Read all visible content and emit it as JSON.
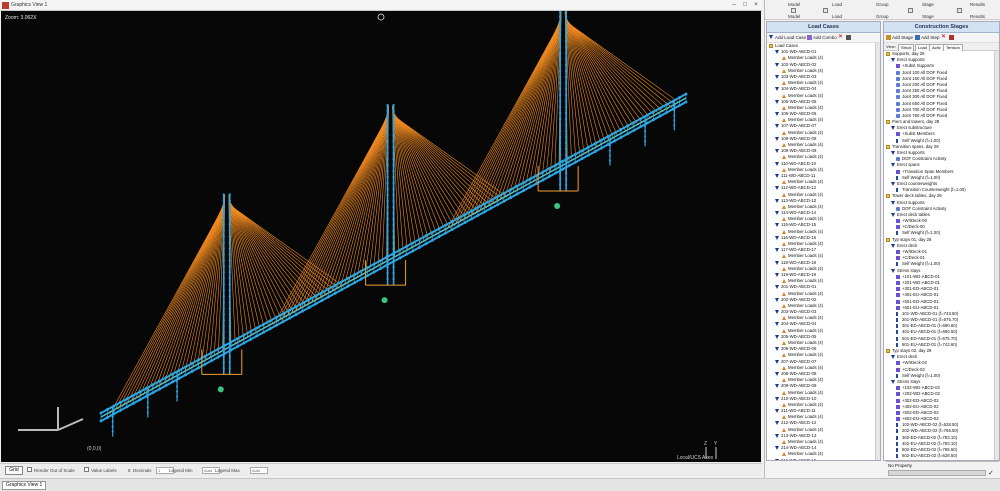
{
  "graphics_view": {
    "title": "Graphics View 1",
    "zoom": "Zoom: 3.062X",
    "origin": "(0,0,0)",
    "local_axes": "Local/UCS Axes",
    "axis_z": "Z",
    "axis_y": "Y",
    "colors": {
      "background": "#070707",
      "cable": "#f08a20",
      "member": "#2aa8e8",
      "deck_hl": "#4ec8d0",
      "support": "#f0a030"
    }
  },
  "status_bar": {
    "grid": "Grid",
    "render_out_of_scale": "Render Out of Scale",
    "value_labels": "Value Labels",
    "decimals_value": "8",
    "decimals_label": "Decimals",
    "legend_min_value": "1",
    "legend_min_label": "Legend Min",
    "legend_min_auto": "Auto",
    "legend_max_label": "Legend Max",
    "legend_max_auto": "Auto"
  },
  "bottom_tab": "Graphics View 1",
  "toolbar": {
    "groups": [
      {
        "top": "Model",
        "bottom": "Model"
      },
      {
        "top": "Load",
        "bottom": "Load"
      },
      {
        "top": "Group",
        "bottom": "Group"
      },
      {
        "top": "Stage",
        "bottom": "Stage"
      },
      {
        "top": "Results",
        "bottom": "Results"
      }
    ]
  },
  "load_cases": {
    "header": "Load Cases",
    "add_load_case": "Add Load Case",
    "add_combo": "Add Combo",
    "root": "Load Cases",
    "items": [
      "101-WD-ABCD-01",
      "102-WD-ABCD-02",
      "103-WD-ABCD-03",
      "104-WD-ABCD-04",
      "105-WD-ABCD-05",
      "106-WD-ABCD-06",
      "107-WD-ABCD-07",
      "108-WD-ABCD-08",
      "109-WD-ABCD-09",
      "110-WD-ABCD-10",
      "111-WD-ABCD-11",
      "112-WD-ABCD-12",
      "113-WD-ABCD-13",
      "114-WD-ABCD-14",
      "115-WD-ABCD-15",
      "116-WD-ABCD-16",
      "117-WD-ABCD-17",
      "118-WD-ABCD-18",
      "119-WD-ABCD-19",
      "201-WD-ABCD-01",
      "202-WD-ABCD-02",
      "203-WD-ABCD-03",
      "204-WD-ABCD-04",
      "205-WD-ABCD-05",
      "206-WD-ABCD-06",
      "207-WD-ABCD-07",
      "208-WD-ABCD-08",
      "209-WD-ABCD-09",
      "210-WD-ABCD-10",
      "211-WD-ABCD-11",
      "212-WD-ABCD-12",
      "213-WD-ABCD-13",
      "214-WD-ABCD-14",
      "215-WD-ABCD-15",
      "216-WD-ABCD-16"
    ],
    "child": "Member Loads (4)"
  },
  "construction_stages": {
    "header": "Construction Stages",
    "add_stage": "Add Stage",
    "add_step": "Add Step",
    "view_label": "View:",
    "subtabs": [
      "Struct",
      "Load",
      "Activ",
      "Tension"
    ],
    "rows": [
      {
        "lvl": 0,
        "kind": "folder",
        "text": "Supports, day 28"
      },
      {
        "lvl": 1,
        "kind": "step",
        "text": "Erect supports"
      },
      {
        "lvl": 2,
        "kind": "plus",
        "text": "+Subst Supports"
      },
      {
        "lvl": 2,
        "kind": "joint",
        "text": "Joint 100 All DOF Fixed"
      },
      {
        "lvl": 2,
        "kind": "joint",
        "text": "Joint 150 All DOF Fixed"
      },
      {
        "lvl": 2,
        "kind": "joint",
        "text": "Joint 200 All DOF Fixed"
      },
      {
        "lvl": 2,
        "kind": "joint",
        "text": "Joint 250 All DOF Fixed"
      },
      {
        "lvl": 2,
        "kind": "joint",
        "text": "Joint 300 All DOF Fixed"
      },
      {
        "lvl": 2,
        "kind": "joint",
        "text": "Joint 650 All DOF Fixed"
      },
      {
        "lvl": 2,
        "kind": "joint",
        "text": "Joint 700 All DOF Fixed"
      },
      {
        "lvl": 2,
        "kind": "joint",
        "text": "Joint 750 All DOF Fixed"
      },
      {
        "lvl": 0,
        "kind": "folder",
        "text": "Piers and towers, day 28"
      },
      {
        "lvl": 1,
        "kind": "step",
        "text": "Erect substructure"
      },
      {
        "lvl": 2,
        "kind": "plus",
        "text": "+Subst Members"
      },
      {
        "lvl": 2,
        "kind": "weight",
        "text": "Self Weight (f=1.00)"
      },
      {
        "lvl": 0,
        "kind": "folder",
        "text": "Transition spans, day 28"
      },
      {
        "lvl": 1,
        "kind": "step",
        "text": "Erect supports"
      },
      {
        "lvl": 2,
        "kind": "joint",
        "text": "DOF Constraint Activity"
      },
      {
        "lvl": 1,
        "kind": "step",
        "text": "Erect spans"
      },
      {
        "lvl": 2,
        "kind": "plus",
        "text": "+Transition Span Members"
      },
      {
        "lvl": 2,
        "kind": "weight",
        "text": "Self Weight (f=1.00)"
      },
      {
        "lvl": 1,
        "kind": "step",
        "text": "Erect counterweights"
      },
      {
        "lvl": 2,
        "kind": "weight",
        "text": "Transition Counterweight (f=1.00)"
      },
      {
        "lvl": 0,
        "kind": "folder",
        "text": "Tower deck tables, day 28"
      },
      {
        "lvl": 1,
        "kind": "step",
        "text": "Erect supports"
      },
      {
        "lvl": 2,
        "kind": "joint",
        "text": "DOF Constraint Activity"
      },
      {
        "lvl": 1,
        "kind": "step",
        "text": "Erect deck tables"
      },
      {
        "lvl": 2,
        "kind": "plus",
        "text": "+W/IDeck-00"
      },
      {
        "lvl": 2,
        "kind": "plus",
        "text": "+C/Deck-00"
      },
      {
        "lvl": 2,
        "kind": "weight",
        "text": "Self Weight (f=1.00)"
      },
      {
        "lvl": 0,
        "kind": "folder",
        "text": "Typ stays 01, day 28"
      },
      {
        "lvl": 1,
        "kind": "step",
        "text": "Erect deck"
      },
      {
        "lvl": 2,
        "kind": "plus",
        "text": "+W/IDeck-01"
      },
      {
        "lvl": 2,
        "kind": "plus",
        "text": "+C/Deck-01"
      },
      {
        "lvl": 2,
        "kind": "weight",
        "text": "Self Weight (f=1.00)"
      },
      {
        "lvl": 1,
        "kind": "step",
        "text": "Stress stays"
      },
      {
        "lvl": 2,
        "kind": "plus",
        "text": "+101-WD-ABCD-01"
      },
      {
        "lvl": 2,
        "kind": "plus",
        "text": "+201-WD-ABCD-01"
      },
      {
        "lvl": 2,
        "kind": "plus",
        "text": "+301-ED-ABCD-01"
      },
      {
        "lvl": 2,
        "kind": "plus",
        "text": "+401-EU-ABCD-01"
      },
      {
        "lvl": 2,
        "kind": "plus",
        "text": "+501-ED-ABCD-01"
      },
      {
        "lvl": 2,
        "kind": "plus",
        "text": "+601-EU-ABCD-01"
      },
      {
        "lvl": 2,
        "kind": "weight",
        "text": "101-WD-ABCD-01 (f=743.60)"
      },
      {
        "lvl": 2,
        "kind": "weight",
        "text": "201-WD-ABCD-01 (f=675.70)"
      },
      {
        "lvl": 2,
        "kind": "weight",
        "text": "301-ED-ABCD-01 (f=690.60)"
      },
      {
        "lvl": 2,
        "kind": "weight",
        "text": "401-EU-ABCD-01 (f=690.50)"
      },
      {
        "lvl": 2,
        "kind": "weight",
        "text": "501-ED-ABCD-01 (f=675.70)"
      },
      {
        "lvl": 2,
        "kind": "weight",
        "text": "601-EU-ABCD-01 (f=743.60)"
      },
      {
        "lvl": 0,
        "kind": "folder",
        "text": "Typ stays 02, day 28"
      },
      {
        "lvl": 1,
        "kind": "step",
        "text": "Erect deck"
      },
      {
        "lvl": 2,
        "kind": "plus",
        "text": "+W/IDeck-02"
      },
      {
        "lvl": 2,
        "kind": "plus",
        "text": "+C/Deck-02"
      },
      {
        "lvl": 2,
        "kind": "weight",
        "text": "Self Weight (f=1.00)"
      },
      {
        "lvl": 1,
        "kind": "step",
        "text": "Stress stays"
      },
      {
        "lvl": 2,
        "kind": "plus",
        "text": "+102-WD-ABCD-02"
      },
      {
        "lvl": 2,
        "kind": "plus",
        "text": "+202-WD-ABCD-02"
      },
      {
        "lvl": 2,
        "kind": "plus",
        "text": "+302-ED-ABCD-02"
      },
      {
        "lvl": 2,
        "kind": "plus",
        "text": "+402-EU-ABCD-02"
      },
      {
        "lvl": 2,
        "kind": "plus",
        "text": "+502-ED-ABCD-02"
      },
      {
        "lvl": 2,
        "kind": "plus",
        "text": "+602-EU-ABCD-02"
      },
      {
        "lvl": 2,
        "kind": "weight",
        "text": "102-WD-ABCD-02 (f=628.50)"
      },
      {
        "lvl": 2,
        "kind": "weight",
        "text": "202-WD-ABCD-02 (f=765.50)"
      },
      {
        "lvl": 2,
        "kind": "weight",
        "text": "302-ED-ABCD-02 (f=783.10)"
      },
      {
        "lvl": 2,
        "kind": "weight",
        "text": "402-EU-ABCD-02 (f=783.10)"
      },
      {
        "lvl": 2,
        "kind": "weight",
        "text": "502-ED-ABCD-02 (f=765.50)"
      },
      {
        "lvl": 2,
        "kind": "weight",
        "text": "602-EU-ABCD-02 (f=628.50)"
      }
    ]
  },
  "property_panel": {
    "label": "No Property"
  }
}
